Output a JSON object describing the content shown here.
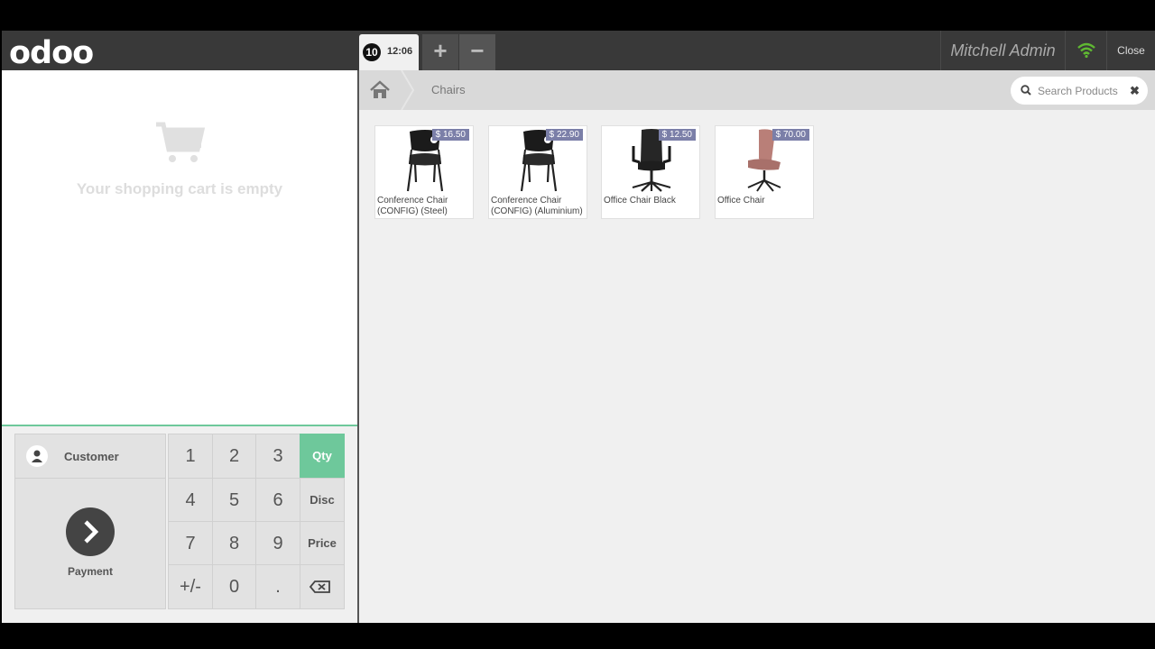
{
  "app": {
    "logo": "odoo"
  },
  "order": {
    "number": "10",
    "time": "12:06",
    "add_label": "+",
    "remove_label": "−"
  },
  "header": {
    "user": "Mitchell Admin",
    "close_label": "Close",
    "wifi_color": "#5fb832"
  },
  "cart": {
    "empty_text": "Your shopping cart is empty"
  },
  "actionpad": {
    "customer_label": "Customer",
    "payment_label": "Payment"
  },
  "numpad": {
    "keys": [
      "1",
      "2",
      "3",
      "4",
      "5",
      "6",
      "7",
      "8",
      "9",
      "+/-",
      "0",
      "."
    ],
    "modes": [
      "Qty",
      "Disc",
      "Price"
    ],
    "active_mode": "Qty",
    "active_color": "#6ec89b"
  },
  "breadcrumb": {
    "category": "Chairs"
  },
  "search": {
    "placeholder": "Search Products"
  },
  "products": [
    {
      "name": "Conference Chair (CONFIG) (Steel)",
      "price": "$ 16.50",
      "image": "conference-chair-steel"
    },
    {
      "name": "Conference Chair (CONFIG) (Aluminium)",
      "price": "$ 22.90",
      "image": "conference-chair-aluminium"
    },
    {
      "name": "Office Chair Black",
      "price": "$ 12.50",
      "image": "office-chair-black"
    },
    {
      "name": "Office Chair",
      "price": "$ 70.00",
      "image": "office-chair-pink"
    }
  ]
}
